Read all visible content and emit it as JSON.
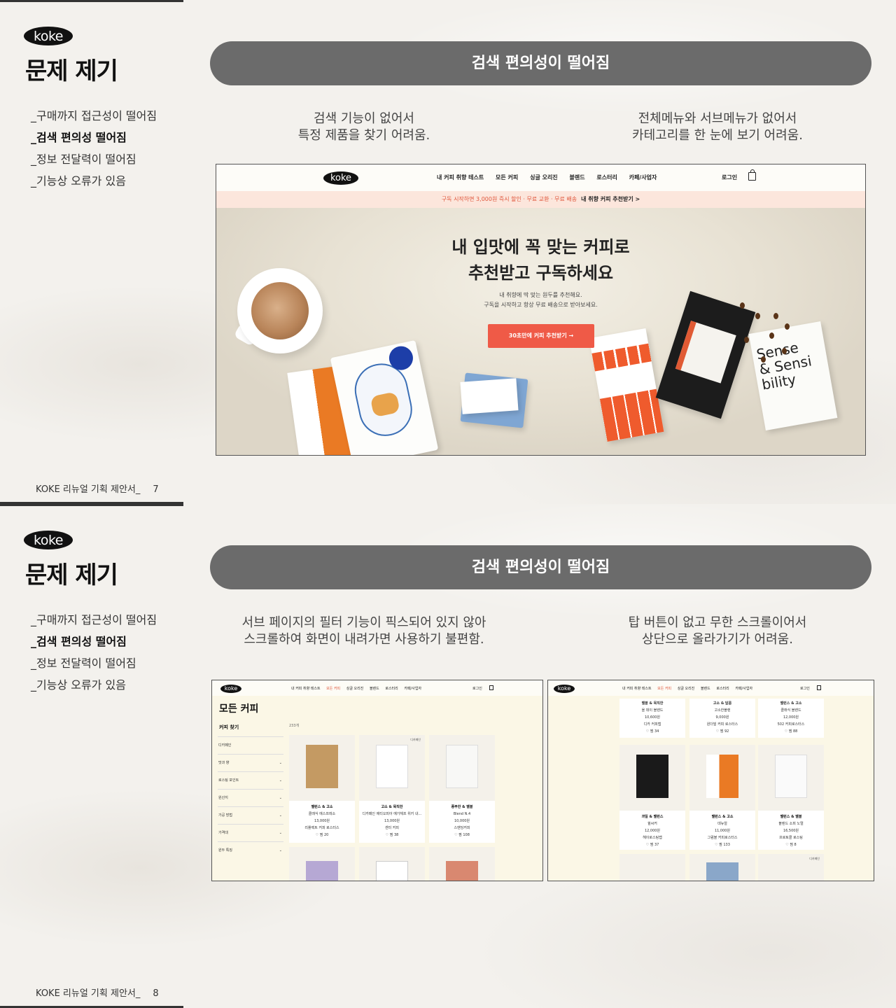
{
  "slides": [
    {
      "logo": "koke",
      "title": "문제 제기",
      "menu": [
        "_구매까지 접근성이 떨어짐",
        "_검색 편의성 떨어짐",
        "_정보 전달력이 떨어짐",
        "_기능상 오류가 있음"
      ],
      "active_index": 1,
      "footer": "KOKE 리뉴얼 기획 제안서_",
      "page_number": "7",
      "headline": "검색 편의성이 떨어짐",
      "desc_left": "검색 기능이 없어서\n특정 제품을 찾기 어려움.",
      "desc_right": "전체메뉴와 서브메뉴가 없어서\n카테고리를 한 눈에 보기 어려움."
    },
    {
      "logo": "koke",
      "title": "문제 제기",
      "menu": [
        "_구매까지 접근성이 떨어짐",
        "_검색 편의성 떨어짐",
        "_정보 전달력이 떨어짐",
        "_기능상 오류가 있음"
      ],
      "active_index": 1,
      "footer": "KOKE 리뉴얼 기획 제안서_",
      "page_number": "8",
      "headline": "검색 편의성이 떨어짐",
      "desc_left": "서브 페이지의 필터 기능이 픽스되어 있지 않아\n스크롤하여 화면이 내려가면 사용하기 불편함.",
      "desc_right": "탑 버튼이 없고 무한 스크롤이어서\n상단으로 올라가기가 어려움."
    }
  ],
  "site": {
    "logo": "koke",
    "nav": [
      "내 커피 취향 테스트",
      "모든 커피",
      "싱글 오리진",
      "블렌드",
      "로스터리",
      "카페/사업자"
    ],
    "login": "로그인",
    "banner_text": "구독 시작하면 3,000원 즉시 할인 · 무료 교환 · 무료 배송",
    "banner_link": "내 취향 커피 추천받기 >",
    "hero_title": "내 입맛에 꼭 맞는 커피로\n추천받고 구독하세요",
    "hero_sub": "내 취향에 딱 맞는 원두를 추천해요.\n구독을 시작하고 항상 무료 배송으로 받아보세요.",
    "hero_cta": "30초만에 커피 추천받기 →",
    "sense_text": "Sense\n& Sensi\nbility"
  },
  "list_page": {
    "title": "모든 커피",
    "filter_title": "커피 찾기",
    "count": "233개",
    "filters": [
      "디카페인",
      "맛과 향",
      "로스팅 포인트",
      "원산지",
      "가공 방법",
      "가격대",
      "원두 특징"
    ],
    "products": [
      {
        "tags": "밸런스 & 고소",
        "name": "클래식 에스프레소",
        "price": "13,000원",
        "roaster": "리플렉트 커피 로스터스",
        "likes": "♡ 찜 20"
      },
      {
        "tags": "고소 & 묵직한",
        "name": "디카페인 에티오피아 예가체프 위키 내...",
        "price": "13,000원",
        "roaster": "센터 커피",
        "likes": "♡ 찜 38",
        "badge": "디카페인"
      },
      {
        "tags": "풍부한 & 밸블",
        "name": "Blend N.4",
        "price": "10,000원",
        "roaster": "스맨딩커피",
        "likes": "♡ 찜 108"
      }
    ]
  },
  "scroll_page": {
    "top_row": [
      {
        "tags": "밸블 & 묵직한",
        "name": "올 데이 블렌드",
        "price": "10,600원",
        "roaster": "디카 커피랩",
        "likes": "♡ 찜 34"
      },
      {
        "tags": "고소 & 달콤",
        "name": "고소한블렌",
        "price": "9,000원",
        "roaster": "원더빌 커피 로스터스",
        "likes": "♡ 찜 92"
      },
      {
        "tags": "밸런스 & 고소",
        "name": "클래식 블렌드",
        "price": "12,000원",
        "roaster": "502 커피로스터스",
        "likes": "♡ 찜 88"
      }
    ],
    "mid_row": [
      {
        "tags": "과일 & 밸런스",
        "name": "윌씨커",
        "price": "12,000원",
        "roaster": "헤이로스팅랩",
        "likes": "♡ 찜 37"
      },
      {
        "tags": "밸런스 & 고소",
        "name": "데뉴얼",
        "price": "11,000원",
        "roaster": "그럼블 커피로스터스",
        "likes": "♡ 찜 133"
      },
      {
        "tags": "밸런스 & 밸블",
        "name": "블렌드 소피 노멀",
        "price": "16,500원",
        "roaster": "프로토콜 로스팅",
        "likes": "♡ 찜 8"
      }
    ],
    "badge": "디카페인"
  },
  "colors": {
    "pill": "#6b6b6b",
    "cta": "#ef5a47",
    "banner": "#fce6dc",
    "accent_red": "#e0563b"
  }
}
